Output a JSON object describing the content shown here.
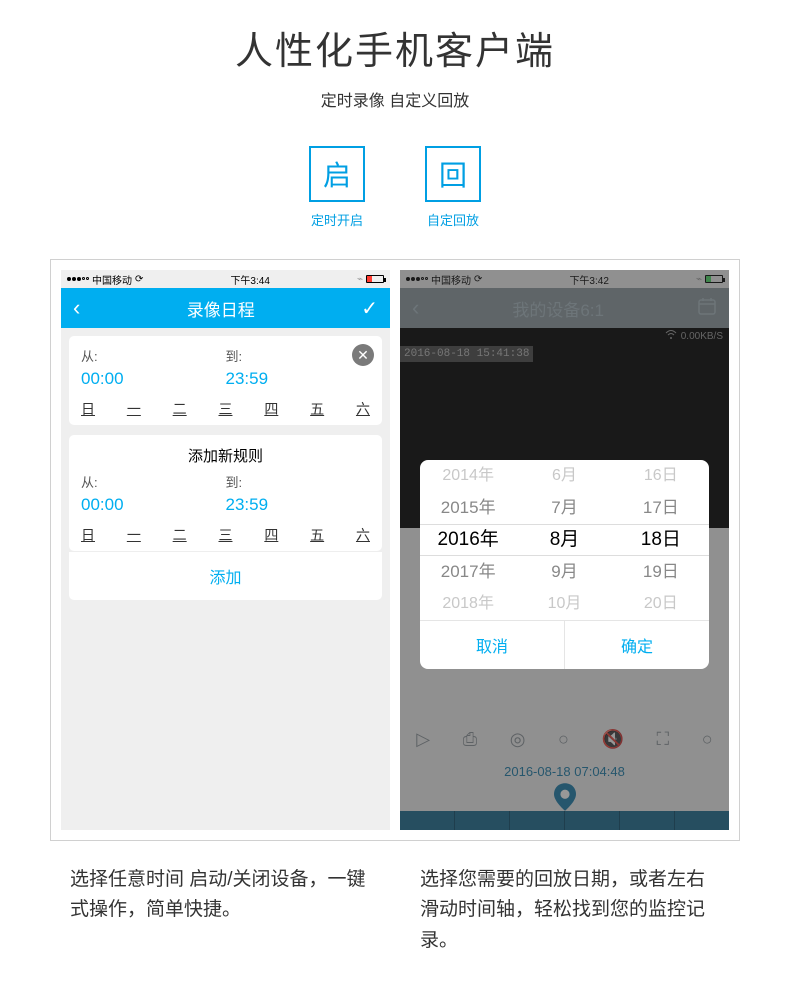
{
  "header": {
    "title": "人性化手机客户端",
    "subtitle": "定时录像 自定义回放"
  },
  "icons": [
    {
      "char": "启",
      "label": "定时开启"
    },
    {
      "char": "回",
      "label": "自定回放"
    }
  ],
  "phone1": {
    "status": {
      "carrier": "中国移动",
      "time": "下午3:44"
    },
    "nav": {
      "title": "录像日程"
    },
    "rule1": {
      "from_label": "从:",
      "to_label": "到:",
      "from_time": "00:00",
      "to_time": "23:59",
      "days": [
        "日",
        "一",
        "二",
        "三",
        "四",
        "五",
        "六"
      ]
    },
    "rule2": {
      "title": "添加新规则",
      "from_label": "从:",
      "to_label": "到:",
      "from_time": "00:00",
      "to_time": "23:59",
      "days": [
        "日",
        "一",
        "二",
        "三",
        "四",
        "五",
        "六"
      ]
    },
    "add_label": "添加"
  },
  "phone2": {
    "status": {
      "carrier": "中国移动",
      "time": "下午3:42"
    },
    "nav": {
      "title": "我的设备6:1"
    },
    "video": {
      "timestamp": "2016-08-18 15:41:38",
      "stats": "0.00KB/S"
    },
    "picker": {
      "years": [
        "2014年",
        "2015年",
        "2016年",
        "2017年",
        "2018年"
      ],
      "months": [
        "6月",
        "7月",
        "8月",
        "9月",
        "10月"
      ],
      "days": [
        "16日",
        "17日",
        "18日",
        "19日",
        "20日"
      ],
      "cancel": "取消",
      "confirm": "确定"
    },
    "timeline": {
      "label": "2016-08-18 07:04:48"
    }
  },
  "captions": {
    "left": "选择任意时间 启动/关闭设备，一键式操作，简单快捷。",
    "right": "选择您需要的回放日期，或者左右滑动时间轴，轻松找到您的监控记录。"
  }
}
